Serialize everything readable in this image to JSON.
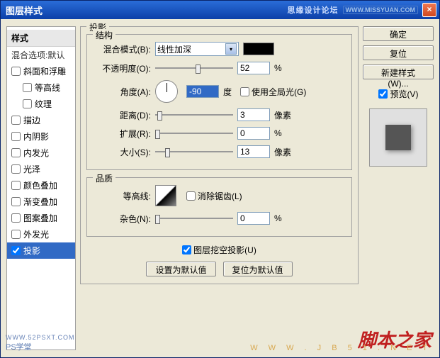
{
  "titlebar": {
    "title": "图层样式",
    "forum": "思缘设计论坛",
    "url": "WWW.MISSYUAN.COM",
    "close": "×"
  },
  "sidebar": {
    "header": "样式",
    "sub": "混合选项:默认",
    "items": [
      {
        "label": "斜面和浮雕",
        "checked": false
      },
      {
        "label": "等高线",
        "checked": false,
        "indent": true
      },
      {
        "label": "纹理",
        "checked": false,
        "indent": true
      },
      {
        "label": "描边",
        "checked": false
      },
      {
        "label": "内阴影",
        "checked": false
      },
      {
        "label": "内发光",
        "checked": false
      },
      {
        "label": "光泽",
        "checked": false
      },
      {
        "label": "颜色叠加",
        "checked": false
      },
      {
        "label": "渐变叠加",
        "checked": false
      },
      {
        "label": "图案叠加",
        "checked": false
      },
      {
        "label": "外发光",
        "checked": false
      },
      {
        "label": "投影",
        "checked": true,
        "selected": true
      }
    ]
  },
  "main": {
    "panel_title": "投影",
    "structure": {
      "legend": "结构",
      "blend_label": "混合模式(B):",
      "blend_value": "线性加深",
      "opacity_label": "不透明度(O):",
      "opacity_value": "52",
      "opacity_unit": "%",
      "opacity_pct": 52,
      "angle_label": "角度(A):",
      "angle_value": "-90",
      "angle_unit": "度",
      "global_light": "使用全局光(G)",
      "global_checked": false,
      "distance_label": "距离(D):",
      "distance_value": "3",
      "distance_unit": "像素",
      "distance_pct": 3,
      "spread_label": "扩展(R):",
      "spread_value": "0",
      "spread_unit": "%",
      "spread_pct": 0,
      "size_label": "大小(S):",
      "size_value": "13",
      "size_unit": "像素",
      "size_pct": 13
    },
    "quality": {
      "legend": "品质",
      "contour_label": "等高线:",
      "antialias": "消除锯齿(L)",
      "antialias_checked": false,
      "noise_label": "杂色(N):",
      "noise_value": "0",
      "noise_unit": "%",
      "noise_pct": 0
    },
    "knockout": {
      "label": "图层挖空投影(U)",
      "checked": true
    },
    "buttons": {
      "default": "设置为默认值",
      "reset": "复位为默认值"
    }
  },
  "right": {
    "ok": "确定",
    "cancel": "复位",
    "new_style": "新建样式(W)...",
    "preview_label": "预览(V)",
    "preview_checked": true
  },
  "watermarks": {
    "ps": "PS学堂",
    "url": "WWW.52PSXT.COM",
    "red": "脚本之家",
    "red2": "W W W . J B 5 1 . N E T"
  }
}
